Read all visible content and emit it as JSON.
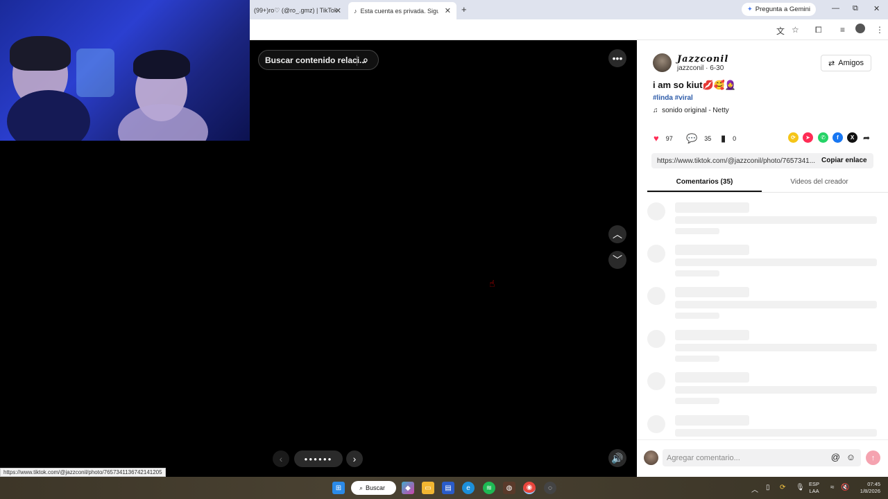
{
  "browser": {
    "tabs": [
      {
        "title": "(99+)ro♡ (@ro_.gmz) | TikTok",
        "active": false
      },
      {
        "title": "Esta cuenta es privada. Sigue es",
        "active": true
      }
    ],
    "new_tab_icon": "plus-icon",
    "gemini_label": "Pregunta a Gemini",
    "status_url": "https://www.tiktok.com/@jazzconil/photo/7657341136742141205"
  },
  "video": {
    "search_placeholder": "Buscar contenido relaci...",
    "photo_indicator": "●●●●●●"
  },
  "post": {
    "display_name": "Jazzconil",
    "username": "jazzconil",
    "date": "6-30",
    "friends_label": "Amigos",
    "caption": "i am so kiut💋🥰🧕",
    "hashtags": "#linda #viral",
    "sound": "sonido original - Netty",
    "likes": "97",
    "comments": "35",
    "saves": "0",
    "link": "https://www.tiktok.com/@jazzconil/photo/7657341...",
    "copy_label": "Copiar enlace",
    "tab_comments": "Comentarios (35)",
    "tab_creator": "Videos del creador",
    "comment_placeholder": "Agregar comentario..."
  },
  "taskbar": {
    "search_label": "Buscar",
    "lang_top": "ESP",
    "lang_bottom": "LAA",
    "time": "07:45",
    "date": "1/8/2026"
  },
  "colors": {
    "like": "#fe2c55",
    "hashtag": "#2b5aa8",
    "send_disabled": "#f5a3b0"
  }
}
